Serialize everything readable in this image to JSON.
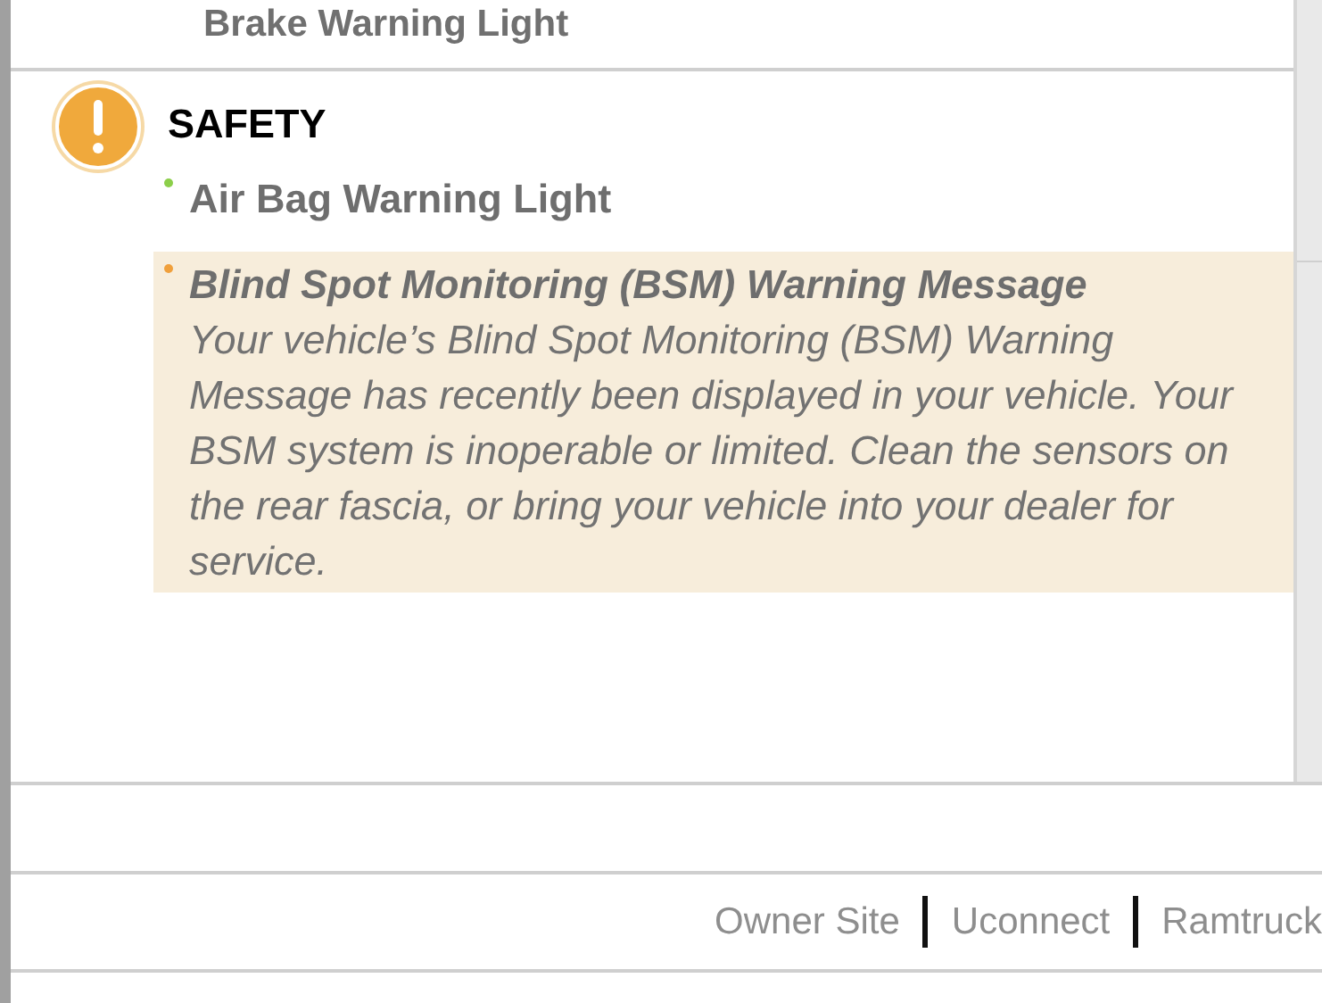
{
  "previous_item": {
    "label": "Brake Warning Light"
  },
  "section": {
    "title": "SAFETY",
    "items": [
      {
        "title": "Air Bag Warning Light",
        "color": "#8ccf4a",
        "selected": false
      },
      {
        "title": "Blind Spot Monitoring (BSM) Warning Message",
        "color": "#f0a03c",
        "selected": true,
        "description": "Your vehicle’s Blind Spot Monitoring (BSM) Warning Message has recently been displayed in your vehicle. Your BSM system is inoperable or limited. Clean the sensors on the rear fascia, or bring your vehicle into your dealer for service."
      }
    ]
  },
  "footer_links": [
    "Owner Site",
    "Uconnect",
    "Ramtruck"
  ]
}
